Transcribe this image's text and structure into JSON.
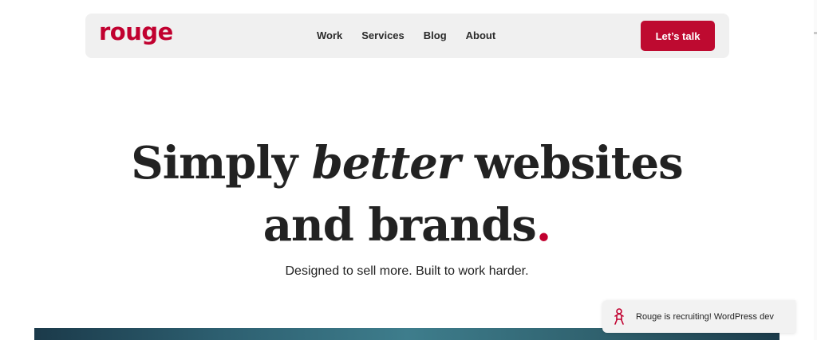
{
  "brand": {
    "logo_text": "rouge",
    "accent_color": "#c1002f"
  },
  "nav": {
    "links": [
      {
        "label": "Work"
      },
      {
        "label": "Services"
      },
      {
        "label": "Blog"
      },
      {
        "label": "About"
      }
    ],
    "cta_label": "Let’s talk"
  },
  "hero": {
    "title_start": "Simply ",
    "title_emphasis": "better",
    "title_middle": " websites",
    "title_end": "and brands",
    "title_dot": ".",
    "subtitle": "Designed to sell more. Built to work harder."
  },
  "toast": {
    "icon": "mascot-icon",
    "text": "Rouge is recruiting! WordPress dev"
  }
}
